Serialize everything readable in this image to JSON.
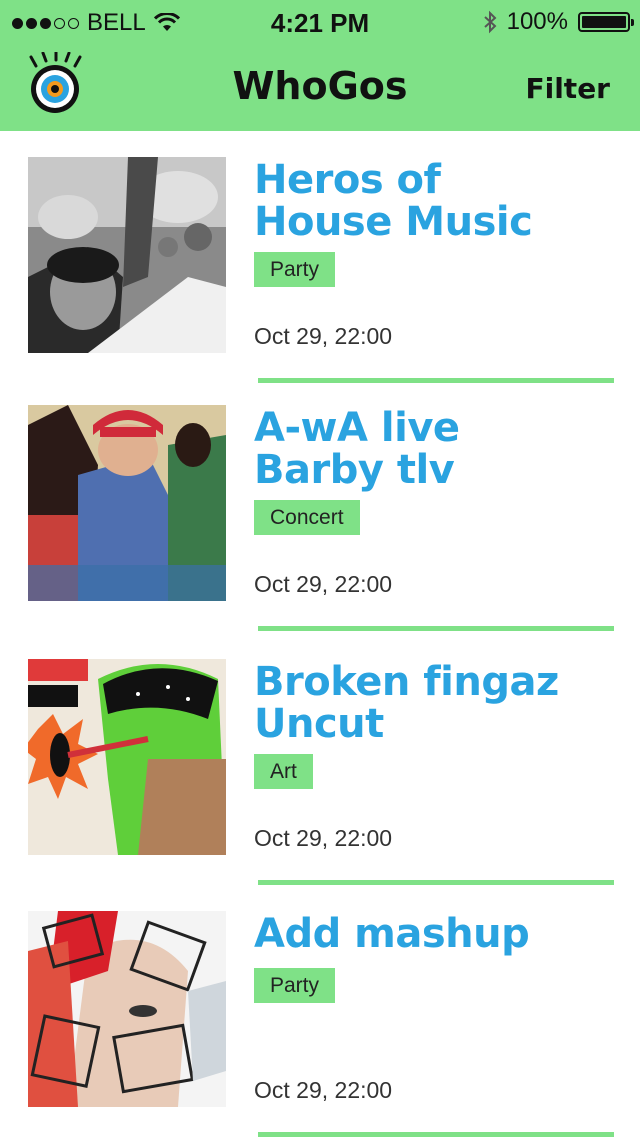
{
  "status_bar": {
    "carrier": "BELL",
    "time": "4:21 PM",
    "battery": "100%",
    "signal_bars_filled": 3,
    "signal_bars_total": 5
  },
  "nav": {
    "title": "WhoGos",
    "filter_label": "Filter",
    "logo_icon": "eye-logo-icon"
  },
  "colors": {
    "accent_green": "#7fe187",
    "title_blue": "#2aa3e0"
  },
  "events": [
    {
      "title": "Heros of\nHouse Music",
      "category": "Party",
      "datetime": "Oct 29, 22:00",
      "image": "crowd-photo"
    },
    {
      "title": "A-wA live\nBarby tlv",
      "category": "Concert",
      "datetime": "Oct 29, 22:00",
      "image": "band-photo"
    },
    {
      "title": "Broken fingaz\nUncut",
      "category": "Art",
      "datetime": "Oct 29, 22:00",
      "image": "street-art-illustration"
    },
    {
      "title": "Add mashup",
      "category": "Party",
      "datetime": "Oct 29, 22:00",
      "image": "collage-portrait"
    }
  ]
}
